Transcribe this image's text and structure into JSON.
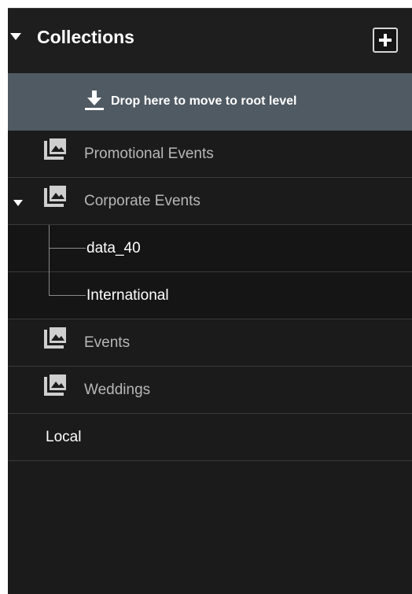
{
  "panel": {
    "title": "Collections",
    "add_icon": "plus-icon",
    "drop_zone": {
      "icon": "download-icon",
      "label": "Drop here to move to root level"
    },
    "collections": [
      {
        "label": "Promotional Events",
        "icon": "collection-icon"
      },
      {
        "label": "Corporate Events",
        "icon": "collection-icon",
        "expanded": true,
        "children": [
          {
            "label": "data_40"
          },
          {
            "label": "International"
          }
        ]
      },
      {
        "label": "Events",
        "icon": "collection-icon"
      },
      {
        "label": "Weddings",
        "icon": "collection-icon"
      }
    ],
    "local_label": "Local"
  },
  "colors": {
    "panel_bg": "#1b1b1b",
    "drop_zone_bg": "#505a62",
    "item_text": "#b7b7b7",
    "child_text": "#ffffff"
  }
}
